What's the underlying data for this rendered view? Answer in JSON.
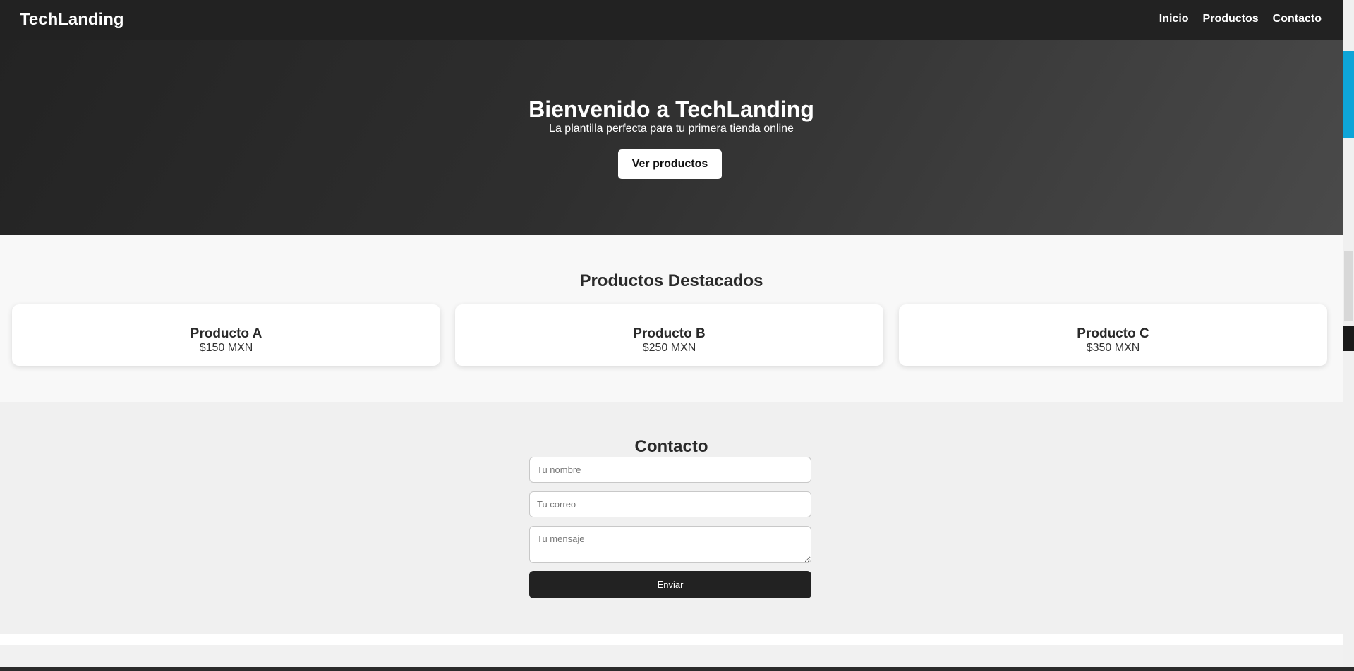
{
  "navbar": {
    "brand": "TechLanding",
    "links": [
      "Inicio",
      "Productos",
      "Contacto"
    ]
  },
  "hero": {
    "title": "Bienvenido a TechLanding",
    "subtitle": "La plantilla perfecta para tu primera tienda online",
    "button_label": "Ver productos"
  },
  "products": {
    "title": "Productos Destacados",
    "items": [
      {
        "name": "Producto A",
        "price": "$150 MXN"
      },
      {
        "name": "Producto B",
        "price": "$250 MXN"
      },
      {
        "name": "Producto C",
        "price": "$350 MXN"
      }
    ]
  },
  "contact": {
    "title": "Contacto",
    "name_placeholder": "Tu nombre",
    "email_placeholder": "Tu correo",
    "message_placeholder": "Tu mensaje",
    "submit_label": "Enviar"
  },
  "colors": {
    "navbar": "#222222",
    "accent": "#0ea5d8",
    "button_dark": "#222222"
  }
}
